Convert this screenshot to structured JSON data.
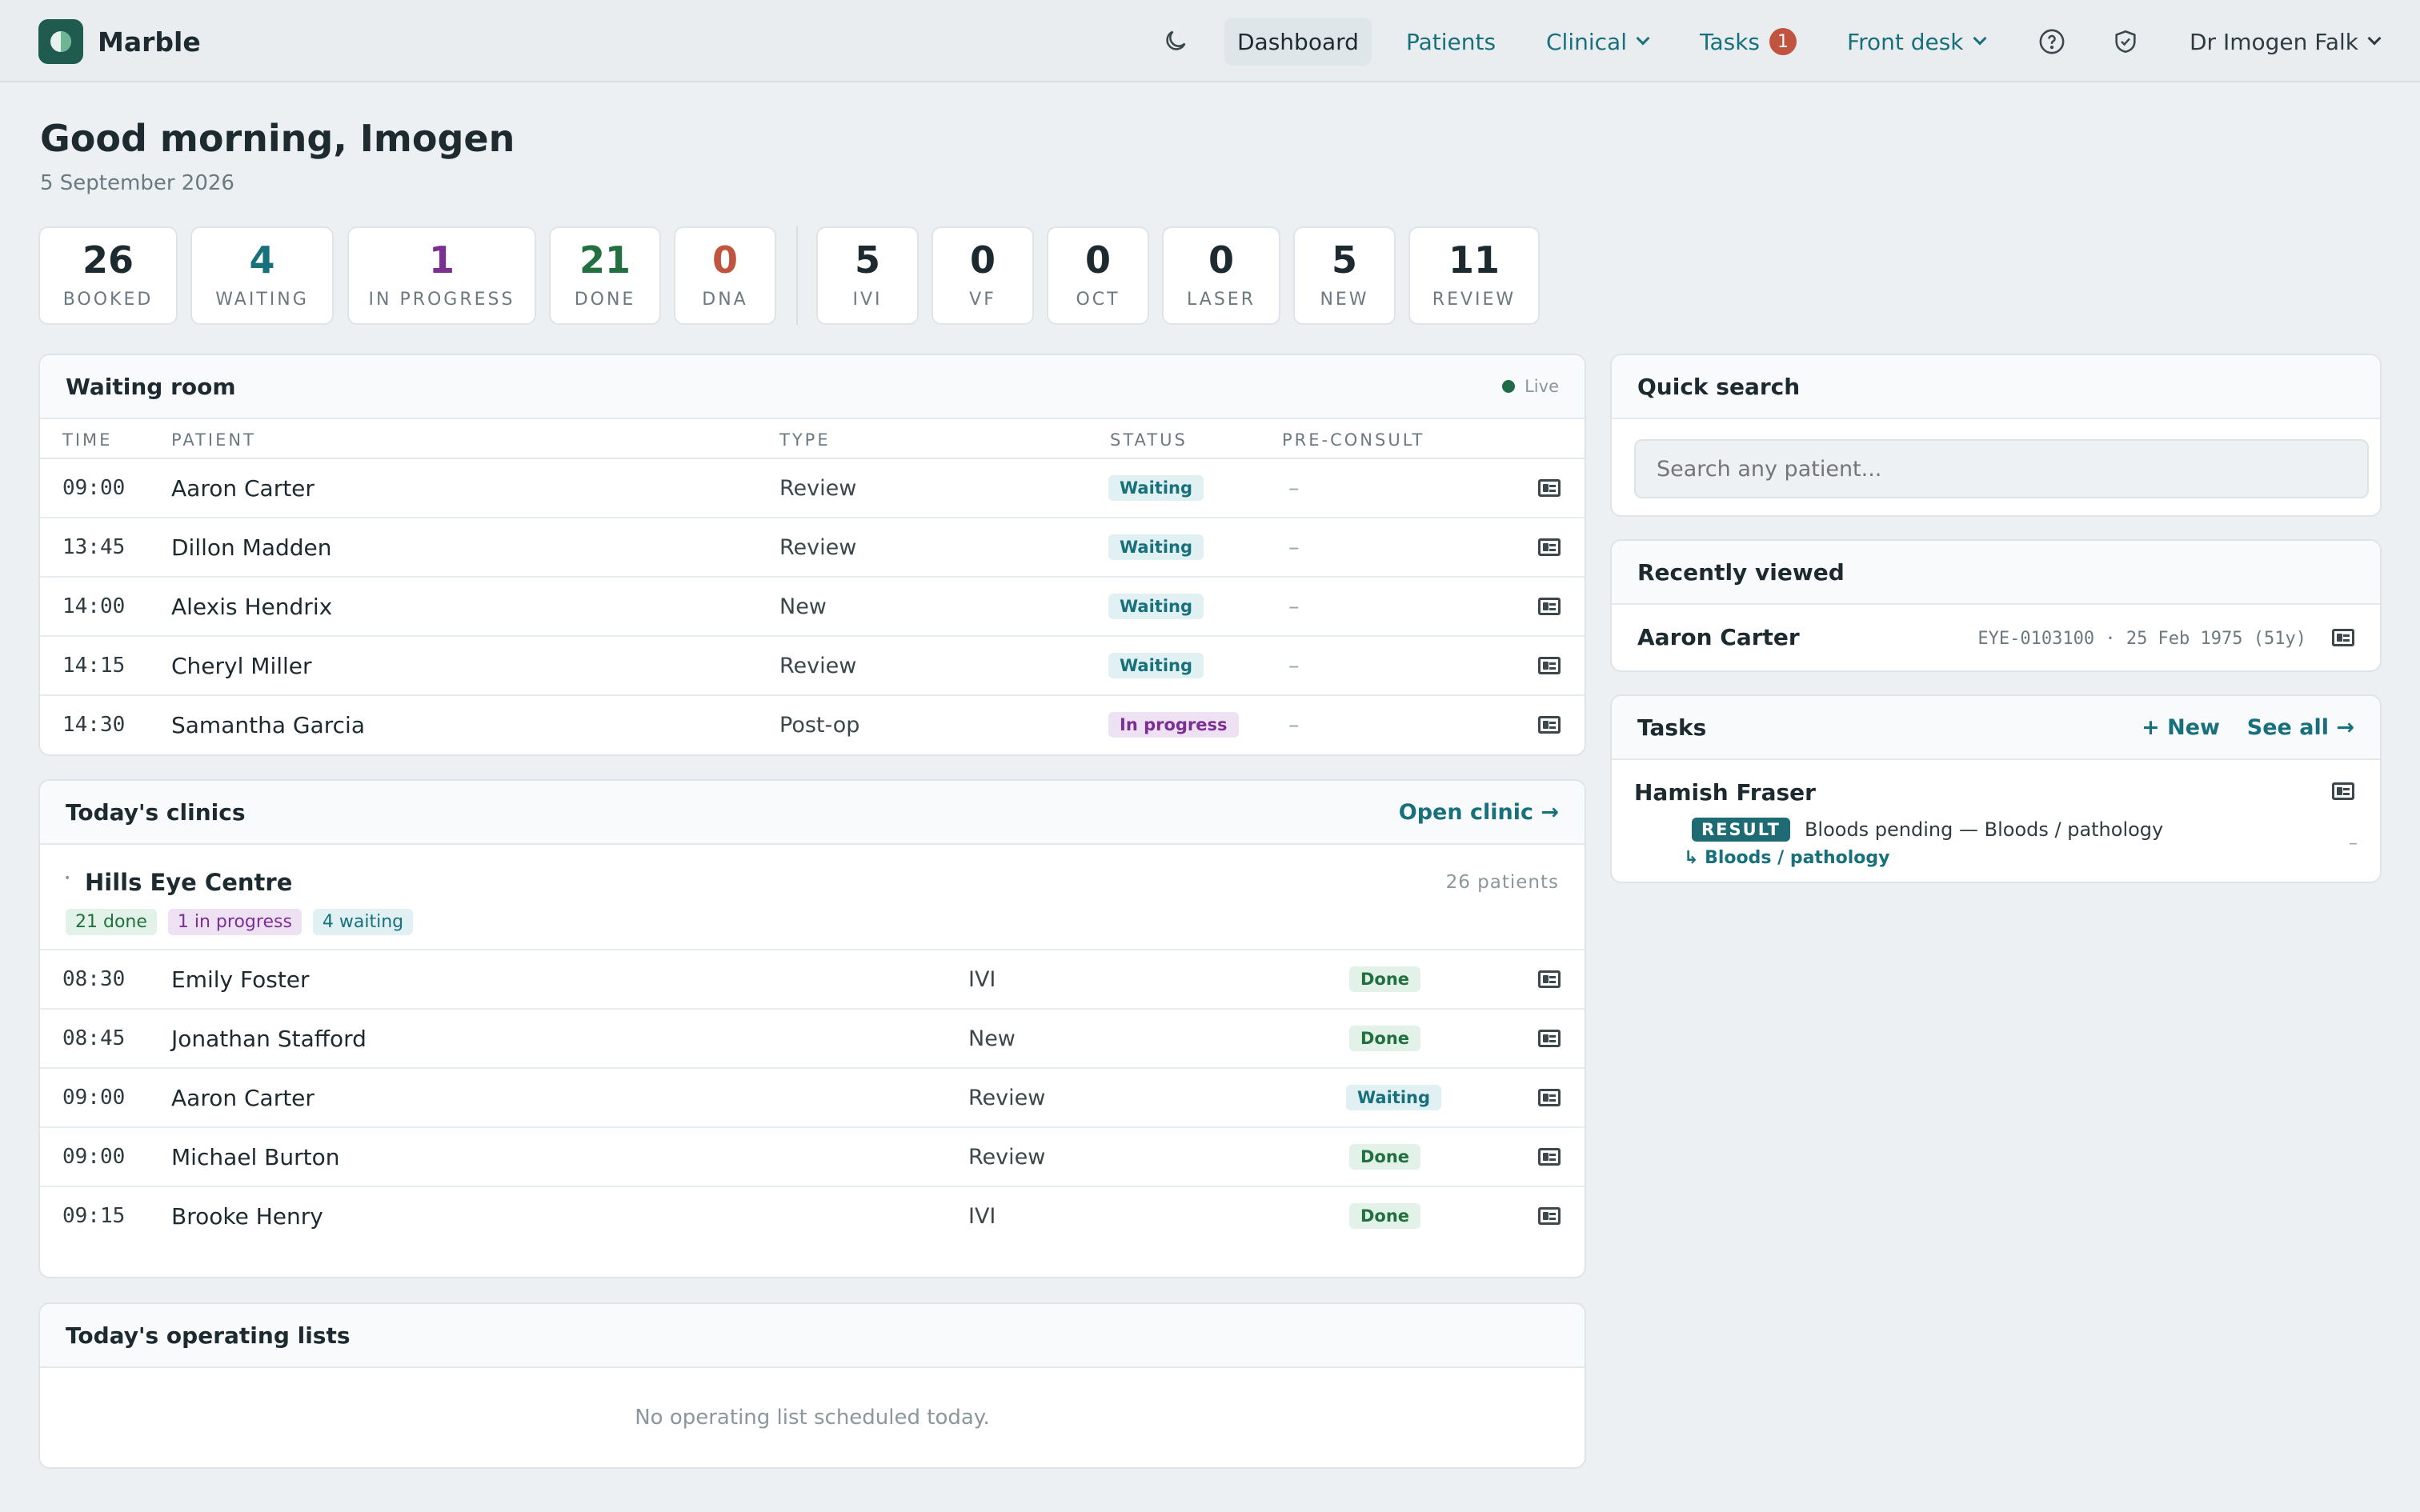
{
  "app": {
    "name": "Marble"
  },
  "nav": {
    "dashboard": "Dashboard",
    "patients": "Patients",
    "clinical": "Clinical",
    "tasks": "Tasks",
    "tasks_count": "1",
    "front_desk": "Front desk",
    "user": "Dr Imogen Falk"
  },
  "greeting": "Good morning, Imogen",
  "date": "5 September 2026",
  "stats": [
    {
      "value": "26",
      "label": "Booked",
      "color": "#1d2a2f"
    },
    {
      "value": "4",
      "label": "Waiting",
      "color": "#17707b"
    },
    {
      "value": "1",
      "label": "In progress",
      "color": "#7a2f93"
    },
    {
      "value": "21",
      "label": "Done",
      "color": "#22703f"
    },
    {
      "value": "0",
      "label": "DNA",
      "color": "#c1543e"
    },
    {
      "value": "5",
      "label": "IVI",
      "color": "#1d2a2f"
    },
    {
      "value": "0",
      "label": "VF",
      "color": "#1d2a2f"
    },
    {
      "value": "0",
      "label": "OCT",
      "color": "#1d2a2f"
    },
    {
      "value": "0",
      "label": "Laser",
      "color": "#1d2a2f"
    },
    {
      "value": "5",
      "label": "New",
      "color": "#1d2a2f"
    },
    {
      "value": "11",
      "label": "Review",
      "color": "#1d2a2f"
    }
  ],
  "waiting_room": {
    "title": "Waiting room",
    "live_label": "Live",
    "columns": {
      "time": "Time",
      "patient": "Patient",
      "type": "Type",
      "status": "Status",
      "preconsult": "Pre-consult"
    },
    "rows": [
      {
        "time": "09:00",
        "patient": "Aaron Carter",
        "type": "Review",
        "status": "Waiting",
        "status_kind": "waiting",
        "preconsult": "–"
      },
      {
        "time": "13:45",
        "patient": "Dillon Madden",
        "type": "Review",
        "status": "Waiting",
        "status_kind": "waiting",
        "preconsult": "–"
      },
      {
        "time": "14:00",
        "patient": "Alexis Hendrix",
        "type": "New",
        "status": "Waiting",
        "status_kind": "waiting",
        "preconsult": "–"
      },
      {
        "time": "14:15",
        "patient": "Cheryl Miller",
        "type": "Review",
        "status": "Waiting",
        "status_kind": "waiting",
        "preconsult": "–"
      },
      {
        "time": "14:30",
        "patient": "Samantha Garcia",
        "type": "Post-op",
        "status": "In progress",
        "status_kind": "inprogress",
        "preconsult": "–"
      }
    ]
  },
  "clinics": {
    "title": "Today's clinics",
    "open_link": "Open clinic →",
    "location": "Hills Eye Centre",
    "patient_count": "26 patients",
    "chips": [
      {
        "label": "21 done",
        "kind": "done"
      },
      {
        "label": "1 in progress",
        "kind": "inprogress"
      },
      {
        "label": "4 waiting",
        "kind": "waiting"
      }
    ],
    "rows": [
      {
        "time": "08:30",
        "patient": "Emily Foster",
        "type": "IVI",
        "status": "Done",
        "status_kind": "done"
      },
      {
        "time": "08:45",
        "patient": "Jonathan Stafford",
        "type": "New",
        "status": "Done",
        "status_kind": "done"
      },
      {
        "time": "09:00",
        "patient": "Aaron Carter",
        "type": "Review",
        "status": "Waiting",
        "status_kind": "waiting"
      },
      {
        "time": "09:00",
        "patient": "Michael Burton",
        "type": "Review",
        "status": "Done",
        "status_kind": "done"
      },
      {
        "time": "09:15",
        "patient": "Brooke Henry",
        "type": "IVI",
        "status": "Done",
        "status_kind": "done"
      }
    ]
  },
  "operating": {
    "title": "Today's operating lists",
    "empty": "No operating list scheduled today."
  },
  "quick_search": {
    "title": "Quick search",
    "placeholder": "Search any patient..."
  },
  "recent": {
    "title": "Recently viewed",
    "patient": "Aaron Carter",
    "meta": "EYE-0103100 · 25 Feb 1975 (51y)"
  },
  "tasks": {
    "title": "Tasks",
    "new_link": "+ New",
    "see_all": "See all →",
    "item": {
      "patient": "Hamish Fraser",
      "tag": "RESULT",
      "text": "Bloods pending — Bloods / pathology",
      "sub": "↳ Bloods / pathology",
      "due": "–"
    }
  }
}
